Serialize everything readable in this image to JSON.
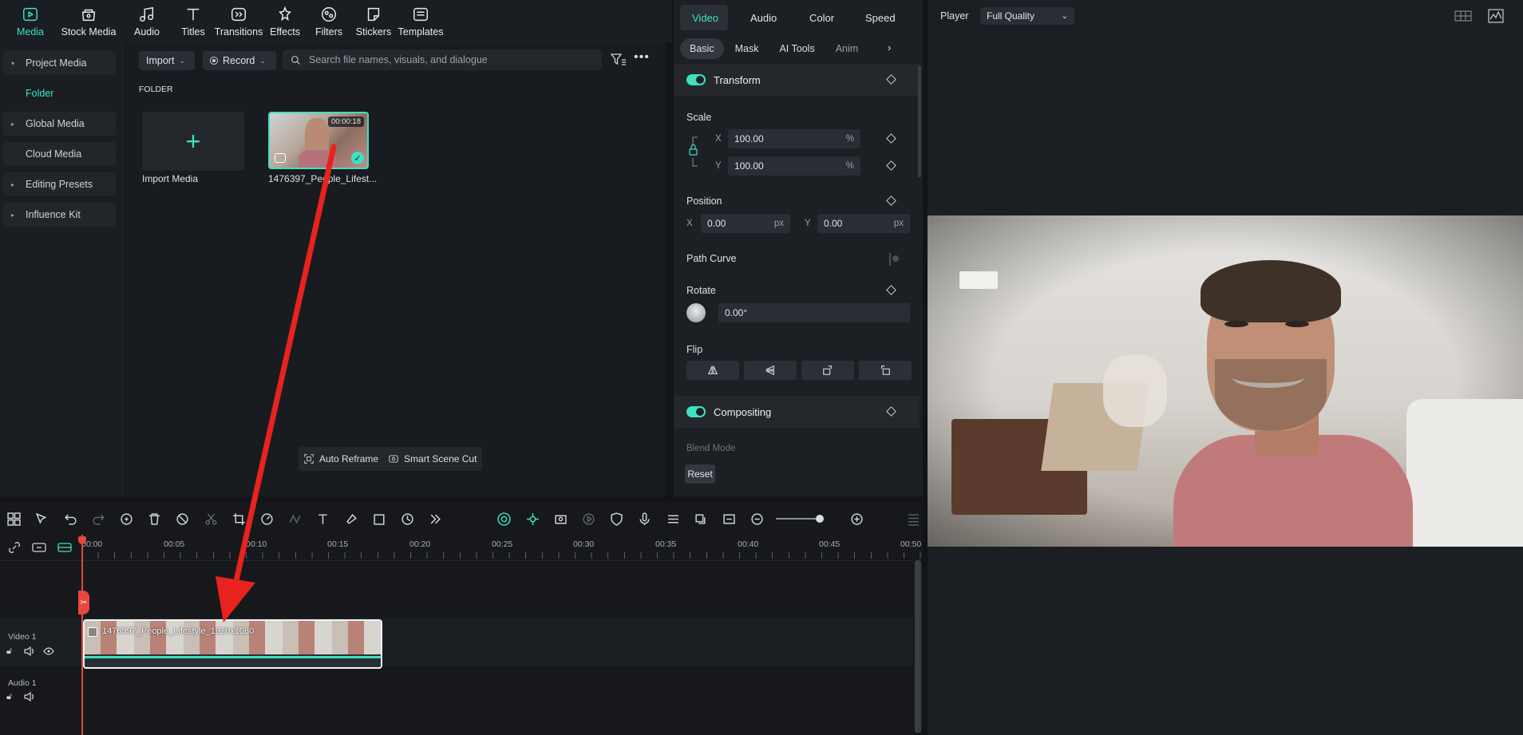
{
  "topbar": {
    "tools": [
      {
        "label": "Media",
        "icon": "media-icon",
        "active": true
      },
      {
        "label": "Stock Media",
        "icon": "stock-media-icon"
      },
      {
        "label": "Audio",
        "icon": "music-note-icon"
      },
      {
        "label": "Titles",
        "icon": "text-t-icon"
      },
      {
        "label": "Transitions",
        "icon": "transitions-icon"
      },
      {
        "label": "Effects",
        "icon": "effects-icon"
      },
      {
        "label": "Filters",
        "icon": "filters-icon"
      },
      {
        "label": "Stickers",
        "icon": "stickers-icon"
      },
      {
        "label": "Templates",
        "icon": "templates-icon"
      }
    ]
  },
  "sidebar": {
    "items": [
      {
        "label": "Project Media",
        "caret": "▾"
      },
      {
        "label": "Folder",
        "sub": true
      },
      {
        "label": "Global Media",
        "caret": "▸"
      },
      {
        "label": "Cloud Media",
        "caret": ""
      },
      {
        "label": "Editing Presets",
        "caret": "▸"
      },
      {
        "label": "Influence Kit",
        "caret": "▸"
      }
    ]
  },
  "media": {
    "import_label": "Import",
    "record_label": "Record",
    "search_placeholder": "Search file names, visuals, and dialogue",
    "folder_heading": "FOLDER",
    "import_media_label": "Import Media",
    "clip_name": "1476397_People_Lifest...",
    "clip_duration": "00:00:18",
    "auto_reframe": "Auto Reframe",
    "smart_scene_cut": "Smart Scene Cut"
  },
  "props": {
    "tabs": [
      "Video",
      "Audio",
      "Color",
      "Speed"
    ],
    "active_tab": "Video",
    "subtabs": [
      "Basic",
      "Mask",
      "AI Tools",
      "Anim"
    ],
    "transform": "Transform",
    "scale": "Scale",
    "scale_x_label": "X",
    "scale_x": "100.00",
    "scale_y_label": "Y",
    "scale_y": "100.00",
    "percent": "%",
    "position": "Position",
    "pos_x_label": "X",
    "pos_x": "0.00",
    "pos_y_label": "Y",
    "pos_y": "0.00",
    "px": "px",
    "path_curve": "Path Curve",
    "rotate": "Rotate",
    "rotate_value": "0.00°",
    "flip": "Flip",
    "compositing": "Compositing",
    "blend_mode": "Blend Mode",
    "reset": "Reset"
  },
  "player": {
    "label": "Player",
    "quality": "Full Quality"
  },
  "timeline": {
    "ticks": [
      "00:00",
      "00:05",
      "00:10",
      "00:15",
      "00:20",
      "00:25",
      "00:30",
      "00:35",
      "00:40",
      "00:45",
      "00:50"
    ],
    "video_track": "Video 1",
    "audio_track": "Audio 1",
    "clip_label": "1476397_People_Lifestyle_1920x1080"
  },
  "colors": {
    "accent": "#3ee0c0",
    "arrow": "#e8221e",
    "playhead": "#e8473f"
  }
}
